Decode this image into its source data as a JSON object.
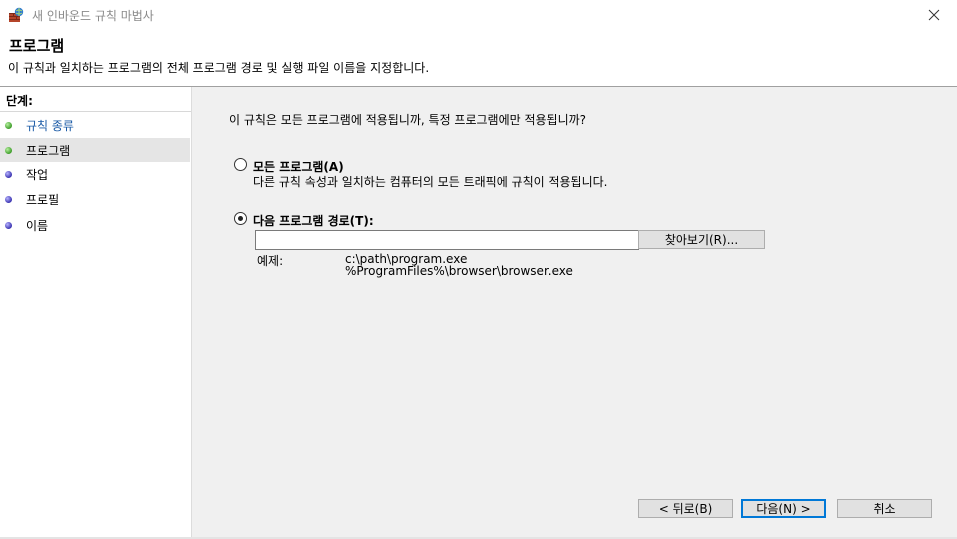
{
  "window": {
    "title": "새 인바운드 규칙 마법사"
  },
  "header": {
    "title": "프로그램",
    "description": "이 규칙과 일치하는 프로그램의 전체 프로그램 경로 및 실행 파일 이름을 지정합니다."
  },
  "steps": {
    "heading": "단계:",
    "items": [
      {
        "label": "규칙 종류",
        "status": "completed",
        "dot_color": "#3e9d2a"
      },
      {
        "label": "프로그램",
        "status": "current",
        "dot_color": "#3e9d2a"
      },
      {
        "label": "작업",
        "status": "pending",
        "dot_color": "#3a33b0"
      },
      {
        "label": "프로필",
        "status": "pending",
        "dot_color": "#3a33b0"
      },
      {
        "label": "이름",
        "status": "pending",
        "dot_color": "#3a33b0"
      }
    ]
  },
  "main": {
    "question": "이 규칙은 모든 프로그램에 적용됩니까, 특정 프로그램에만 적용됩니까?",
    "options": [
      {
        "label": "모든 프로그램(A)",
        "description": "다른 규칙 속성과 일치하는 컴퓨터의 모든 트래픽에 규칙이 적용됩니다.",
        "selected": false
      },
      {
        "label": "다음 프로그램 경로(T):",
        "selected": true
      }
    ],
    "path_value": "",
    "browse_label": "찾아보기(R)...",
    "example_label": "예제:",
    "example_lines": [
      "c:\\path\\program.exe",
      "%ProgramFiles%\\browser\\browser.exe"
    ]
  },
  "buttons": {
    "back": "< 뒤로(B)",
    "next": "다음(N) >",
    "cancel": "취소"
  }
}
